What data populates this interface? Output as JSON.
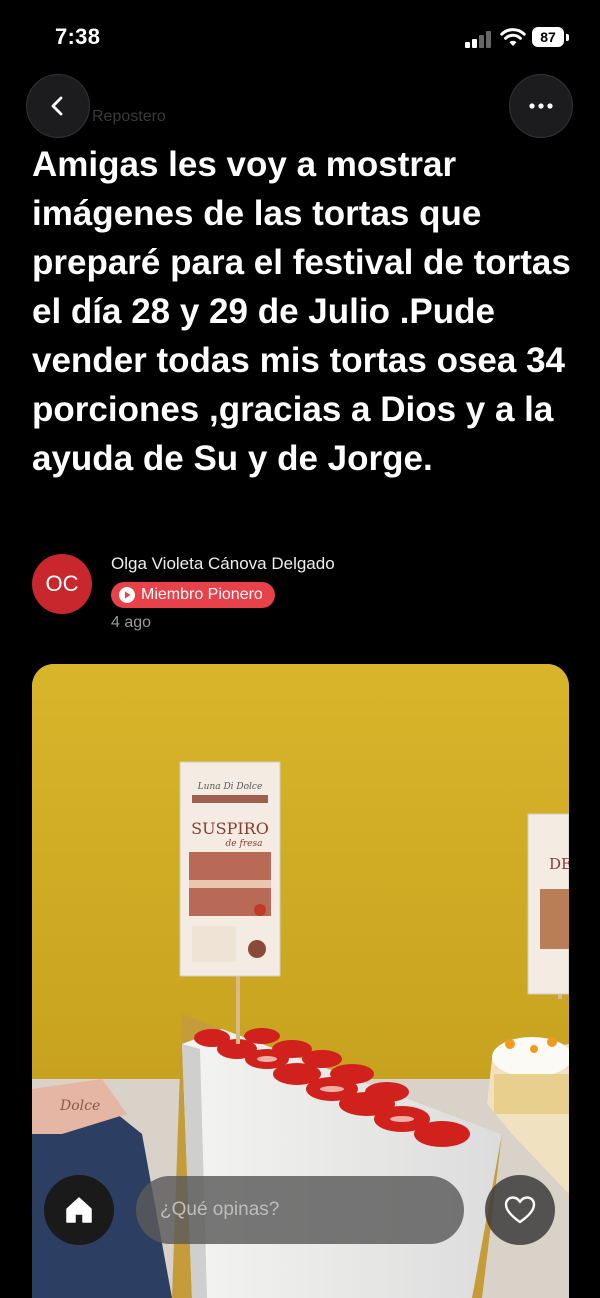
{
  "status_bar": {
    "time": "7:38",
    "battery": "87"
  },
  "header": {
    "back_icon": "chevron-left-icon",
    "more_icon": "ellipsis-icon",
    "group_name": "Repostero"
  },
  "post": {
    "title": "Amigas les voy a mostrar imágenes de las tortas que preparé para el festival de tortas el día 28 y 29 de Julio .Pude vender todas mis tortas osea 34 porciones ,gracias a Dios y a la ayuda de Su y de Jorge.",
    "author": {
      "initials": "OC",
      "name": "Olga Violeta Cánova Delgado",
      "badge": "Miembro Pionero",
      "time_ago": "4 ago",
      "avatar_color": "#c8282d",
      "badge_color": "#e8414a"
    },
    "photo": {
      "sign_left": {
        "brand": "Luna Di Dolce",
        "name": "SUSPIRO",
        "flavor": "de fresa"
      },
      "sign_right": {
        "name": "DE"
      },
      "paper_text": "Dolce"
    }
  },
  "bottom_bar": {
    "home_icon": "home-icon",
    "comment_placeholder": "¿Qué opinas?",
    "like_icon": "heart-icon"
  }
}
